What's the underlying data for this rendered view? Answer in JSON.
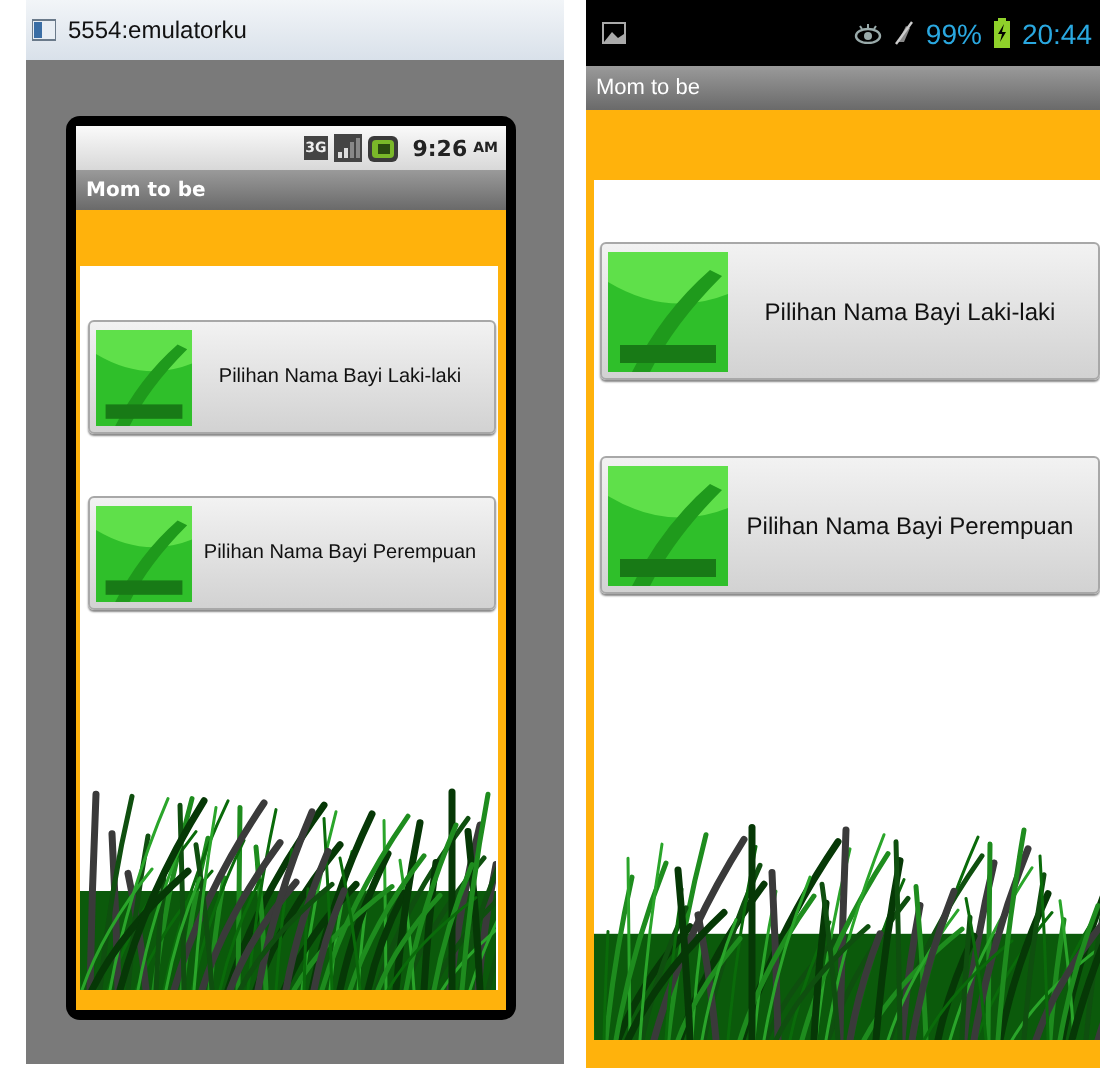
{
  "emulator": {
    "window_title": "5554:emulatorku",
    "status_bar": {
      "network": "3G",
      "time": "9:26",
      "meridiem": "AM"
    },
    "app_title": "Mom to be",
    "buttons": [
      {
        "label": "Pilihan Nama Bayi Laki-laki"
      },
      {
        "label": "Pilihan Nama Bayi Perempuan"
      }
    ]
  },
  "device": {
    "status_bar": {
      "battery": "99%",
      "time": "20:44"
    },
    "app_title": "Mom to be",
    "buttons": [
      {
        "label": "Pilihan Nama Bayi Laki-laki"
      },
      {
        "label": "Pilihan Nama Bayi Perempuan"
      }
    ]
  }
}
